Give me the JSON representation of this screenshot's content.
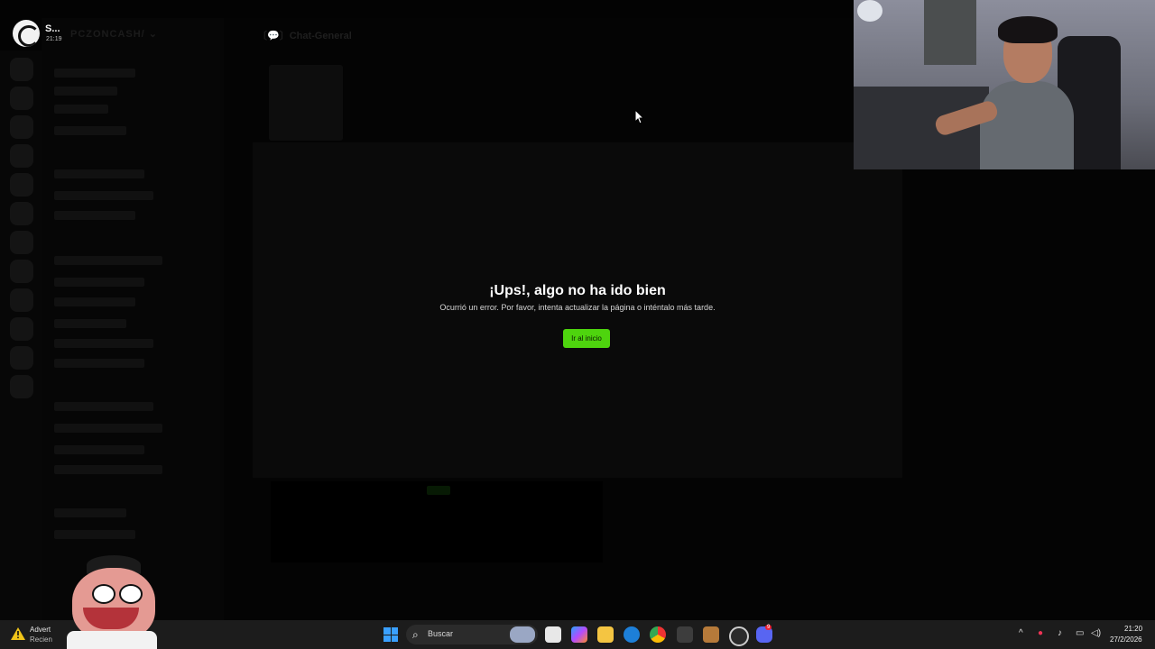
{
  "account": {
    "name": "S...",
    "time": "21:19"
  },
  "background": {
    "server_name": "PCZONCASH/ ⌄",
    "channel_header": "〔💬〕Chat-General"
  },
  "error": {
    "title": "¡Ups!, algo no ha ido bien",
    "message": "Ocurrió un error. Por favor, intenta actualizar la página o inténtalo más tarde.",
    "button": "Ir al inicio"
  },
  "toast": {
    "title": "Advert",
    "subtitle": "Recien"
  },
  "taskbar": {
    "search_placeholder": "Buscar",
    "clock_time": "21:20",
    "clock_date": "27/2/2026",
    "discord_badge": "9"
  },
  "colors": {
    "accent": "#4ed40e",
    "modal_bg": "#0a0a0a",
    "taskbar_bg": "#1c1c1c"
  }
}
